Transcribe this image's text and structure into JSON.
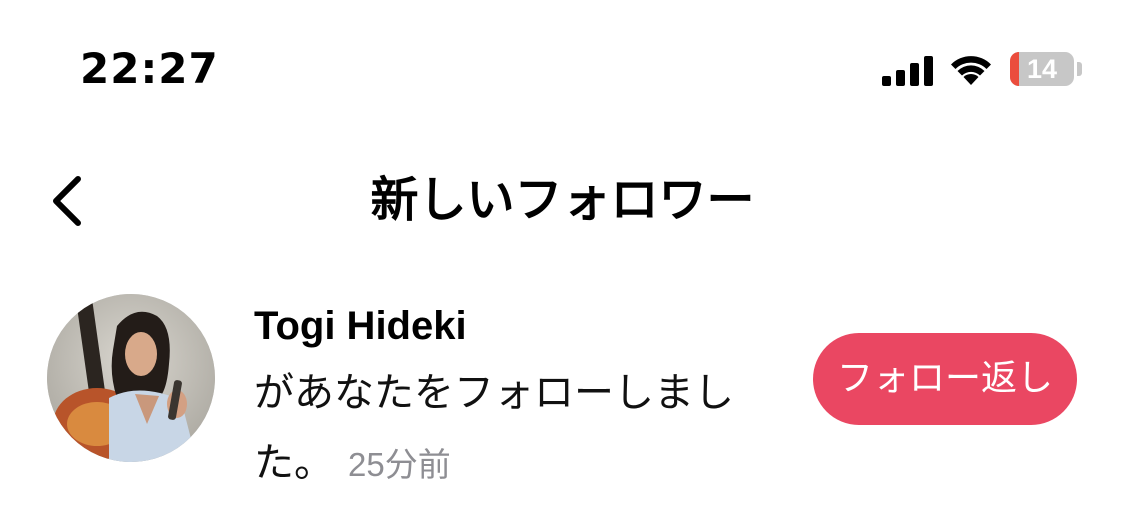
{
  "status_bar": {
    "time": "22:27",
    "battery_level": "14",
    "battery_color": "#eb4d3d",
    "icons": [
      "signal-icon",
      "wifi-icon",
      "battery-icon"
    ]
  },
  "nav": {
    "back_icon": "chevron-left-icon",
    "title": "新しいフォロワー"
  },
  "notification": {
    "user_name": "Togi Hideki",
    "message": "があなたをフォローしました。",
    "time_ago": "25分前",
    "button_label": "フォロー返し",
    "button_color": "#ea4762"
  }
}
